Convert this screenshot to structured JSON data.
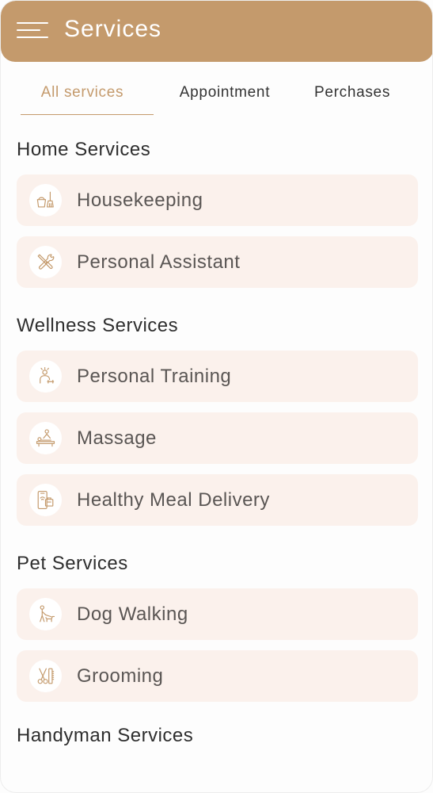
{
  "header": {
    "title": "Services",
    "menu_icon": "menu-icon"
  },
  "tabs": [
    {
      "label": "All services",
      "active": true
    },
    {
      "label": "Appointment",
      "active": false
    },
    {
      "label": "Perchases",
      "active": false
    }
  ],
  "sections": [
    {
      "title": "Home Services",
      "items": [
        {
          "label": "Housekeeping",
          "icon": "housekeeping-icon"
        },
        {
          "label": "Personal Assistant",
          "icon": "tools-icon"
        }
      ]
    },
    {
      "title": "Wellness Services",
      "items": [
        {
          "label": "Personal Training",
          "icon": "trainer-icon"
        },
        {
          "label": "Massage",
          "icon": "massage-icon"
        },
        {
          "label": "Healthy Meal Delivery",
          "icon": "meal-delivery-icon"
        }
      ]
    },
    {
      "title": "Pet Services",
      "items": [
        {
          "label": "Dog Walking",
          "icon": "dog-walking-icon"
        },
        {
          "label": "Grooming",
          "icon": "grooming-icon"
        }
      ]
    },
    {
      "title": "Handyman Services",
      "items": []
    }
  ],
  "colors": {
    "accent": "#C49A6C",
    "card_background": "#FBF1EC",
    "heading_text": "#2E2E2E",
    "item_text": "#5A5654"
  }
}
